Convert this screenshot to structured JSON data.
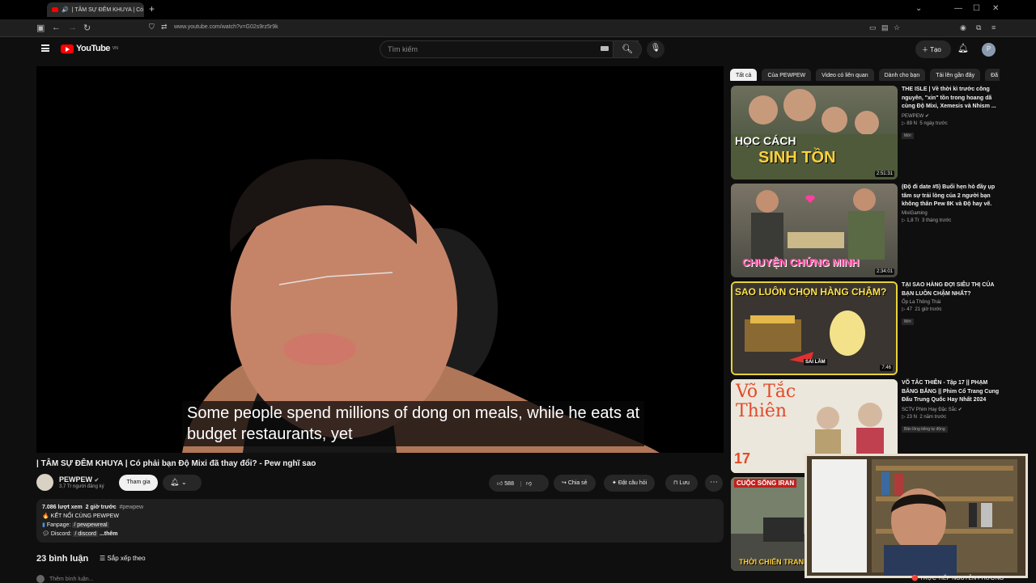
{
  "browser": {
    "tab_title": "| TÂM SỰ ĐÊM KHUYA | Có",
    "tab_close": "✕",
    "new_tab": "+",
    "url": "www.youtube.com/watch?v=G02s9rz5r9k"
  },
  "header": {
    "logo_text": "YouTube",
    "region": "VN",
    "search_placeholder": "Tìm kiếm",
    "create_label": "Tạo",
    "avatar_letter": "P"
  },
  "video": {
    "subtitle_line1": "Some people spend millions of dong on meals, while he eats at",
    "subtitle_line2": "budget restaurants, yet"
  },
  "info": {
    "title": "| TÂM SỰ ĐÊM KHUYA | Có phải bạn Độ Mixi đã thay đổi? - Pew nghĩ sao",
    "channel": "PEWPEW",
    "subscribers": "3,7 Tr người đăng ký",
    "join_label": "Tham gia",
    "likes": "588",
    "share_label": "Chia sẻ",
    "ask_label": "Đặt câu hỏi",
    "save_label": "Lưu",
    "more": "⋯"
  },
  "description": {
    "views": "7.086 lượt xem",
    "time": "2 giờ trước",
    "tag": "#pewpew",
    "line1": "🔥 KẾT NỐI CÙNG PEWPEW",
    "line2_label": "Fanpage:",
    "line2_val": "/ pewpewreal",
    "line3_label": "Discord:",
    "line3_val": "/ discord",
    "more": "...thêm"
  },
  "comments": {
    "count_label": "23 bình luận",
    "sort_label": "Sắp xếp theo",
    "add_placeholder": "Thêm bình luận..."
  },
  "chips": [
    "Tất cả",
    "Của PEWPEW",
    "Video có liên quan",
    "Dành cho bạn",
    "Tải lên gần đây",
    "Đã xem"
  ],
  "recommendations": [
    {
      "title": "THE ISLE | Về thời kì trước công nguyên, \"xin\" tồn trong hoang dã cùng Độ Mixi, Xemesis và Nhism ...",
      "channel": "PEWPEW",
      "views": "89 N",
      "age": "5 ngày trước",
      "badge": "Mới",
      "duration": "2:51:31",
      "thumb_text1": "HỌC CÁCH",
      "thumb_text2": "SINH TỒN"
    },
    {
      "title": "(Độ đi date #5) Buổi hẹn hò đầy ụp tâm sự trải lòng của 2 người bạn không thân Pew 8K và Độ hay vẽ.",
      "channel": "MixiGaming",
      "views": "1,8 Tr",
      "age": "3 tháng trước",
      "badge": "",
      "duration": "2:34:01",
      "thumb_text1": "CHUYỆN CHỨNG MINH",
      "thumb_text2": ""
    },
    {
      "title": "TẠI SAO HÀNG ĐỢI SIÊU THỊ CỦA BẠN LUÔN CHẬM NHẤT?",
      "channel": "Ốp La Thông Thái",
      "views": "47",
      "age": "21 giờ trước",
      "badge": "Mới",
      "duration": "7:46",
      "thumb_text1": "SAO LUÔN CHỌN HÀNG CHẬM?",
      "thumb_text2": "SAI LẦM"
    },
    {
      "title": "VÕ TẮC THIÊN - Tập 17 || PHẠM BĂNG BĂNG || Phim Cổ Trang Cung Đấu Trung Quốc Hay Nhất 2024",
      "channel": "SCTV Phim Hay Đặc Sắc",
      "views": "23 N",
      "age": "2 năm trước",
      "badge": "Bản lồng tiếng tự động",
      "duration": "",
      "thumb_text1": "Võ Tắc Thiên",
      "thumb_text2": "17"
    },
    {
      "title": "",
      "channel": "",
      "views": "",
      "age": "",
      "badge": "",
      "duration": "",
      "thumb_text1": "CUỘC SỐNG IRAN",
      "thumb_text2": "THỜI CHIẾN TRANH"
    }
  ],
  "overlay": {
    "live_label": "TRỰC TIẾP NGUYỄN PHƯƠNG"
  }
}
